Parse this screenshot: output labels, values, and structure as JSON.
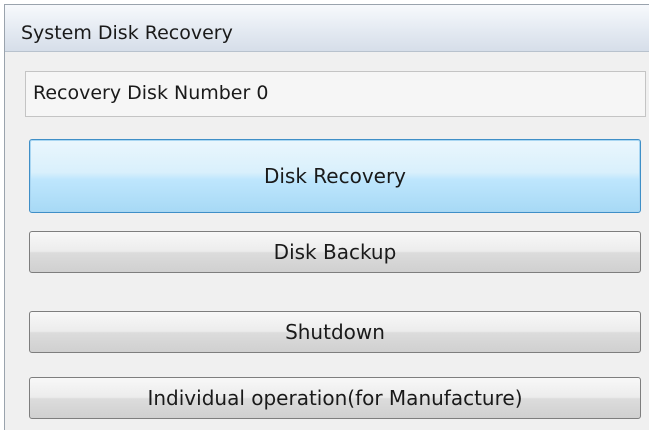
{
  "window": {
    "title": "System Disk Recovery"
  },
  "recovery_disk": {
    "label": "Recovery Disk Number 0"
  },
  "buttons": {
    "disk_recovery": "Disk Recovery",
    "disk_backup": "Disk Backup",
    "shutdown": "Shutdown",
    "individual_operation": "Individual operation(for Manufacture)"
  },
  "colors": {
    "window_background": "#f0f0f0",
    "primary_button_border": "#3f8fc7",
    "primary_button_fill": "#bee6fd",
    "button_border": "#7e7e7e"
  }
}
